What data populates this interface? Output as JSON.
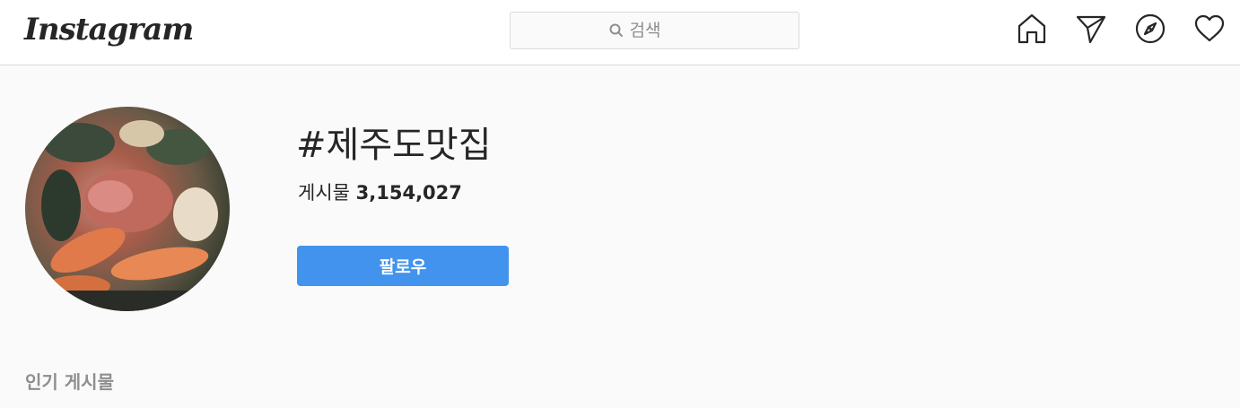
{
  "header": {
    "logo_text": "Instagram",
    "search": {
      "placeholder": "검색"
    },
    "nav_icons": [
      "home-icon",
      "direct-message-icon",
      "explore-compass-icon",
      "activity-heart-icon"
    ]
  },
  "hashtag": {
    "title": "#제주도맛집",
    "posts_label": "게시물",
    "posts_count": "3,154,027"
  },
  "actions": {
    "follow_label": "팔로우"
  },
  "sections": {
    "top_posts_title": "인기 게시물"
  },
  "colors": {
    "follow_button": "#4293ed",
    "background": "#fafafa",
    "header_bg": "#ffffff",
    "border": "#dbdbdb"
  }
}
